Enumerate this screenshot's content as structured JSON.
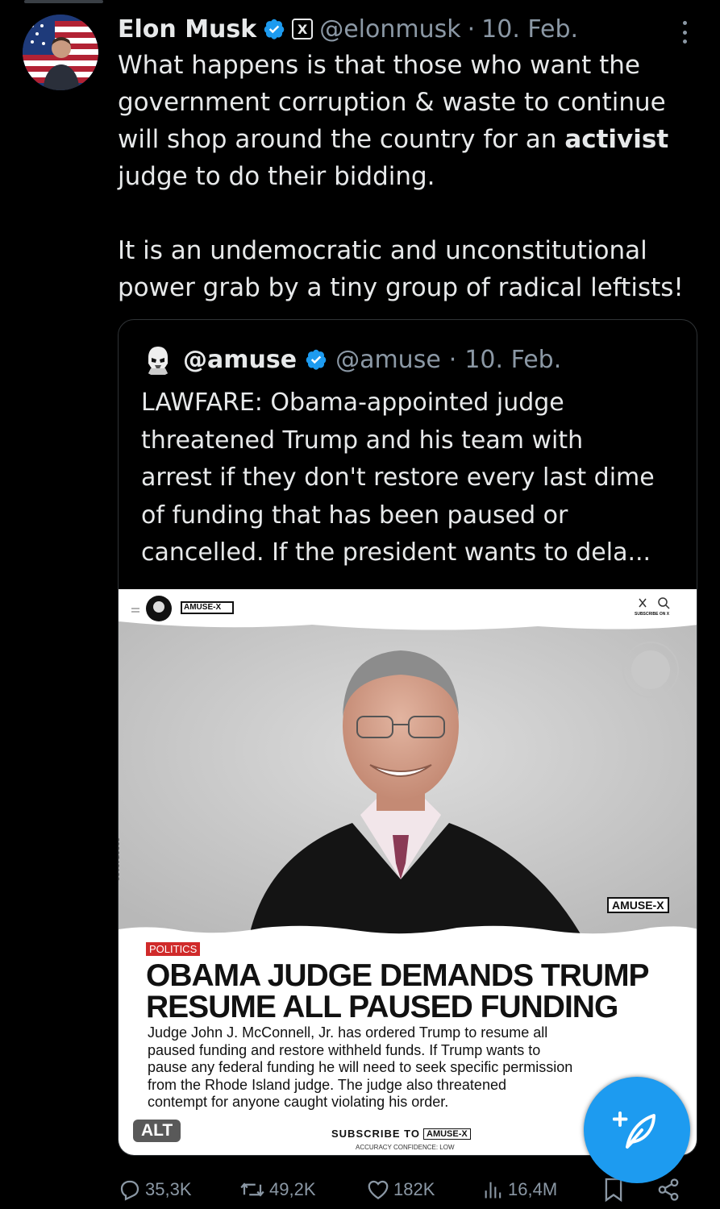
{
  "author": {
    "name": "Elon Musk",
    "handle": "@elonmusk",
    "separator": "·",
    "date": "10. Feb.",
    "affiliation_badge": "X"
  },
  "tweet": {
    "lines_p1": [
      "What happens is that those who want the",
      "government corruption & waste to continue",
      "will shop around the country for an",
      "judge to do their bidding."
    ],
    "bold_word": "activist",
    "lines_p2": [
      "It is an undemocratic and unconstitutional",
      "power grab by a tiny group of radical leftists!"
    ]
  },
  "quoted": {
    "name": "@amuse",
    "handle": "@amuse",
    "separator": "·",
    "date": "10. Feb.",
    "lines": [
      "LAWFARE: Obama-appointed judge",
      "threatened Trump and his team with",
      "arrest if they don't restore every last dime",
      "of funding that has been paused or",
      "cancelled. If the president wants to dela..."
    ],
    "media": {
      "site_logo": "AMUSE-X",
      "subscribe_on_x": "SUBSCRIBE ON X",
      "watermark": "AMUSE-X",
      "photo_id": "2930740138",
      "tag": "POLITICS",
      "headline": [
        "OBAMA JUDGE DEMANDS TRUMP",
        "RESUME ALL PAUSED FUNDING"
      ],
      "article_lines": [
        "Judge John J. McConnell, Jr. has ordered Trump to resume all",
        "paused funding and restore withheld funds. If Trump wants to",
        "pause any federal funding he will need to seek specific permission",
        "from the Rhode Island judge. The judge also threatened",
        "contempt for anyone caught violating his order."
      ],
      "subscribe_prefix": "SUBSCRIBE TO",
      "subscribe_brand": "AMUSE-X",
      "accuracy": "ACCURACY CONFIDENCE: LOW",
      "alt_label": "ALT"
    }
  },
  "actions": {
    "replies": "35,3K",
    "reposts": "49,2K",
    "likes": "182K",
    "views": "16,4M"
  },
  "colors": {
    "background": "#000000",
    "text": "#e7e9ea",
    "muted": "#8b98a5",
    "accent": "#1d9bf0",
    "verified": "#1d9bf0",
    "tag_red": "#d02a2a"
  },
  "icons": [
    "verified-badge-icon",
    "x-affiliation-icon",
    "more-icon",
    "reply-icon",
    "repost-icon",
    "like-icon",
    "views-icon",
    "bookmark-icon",
    "share-icon",
    "compose-icon"
  ]
}
